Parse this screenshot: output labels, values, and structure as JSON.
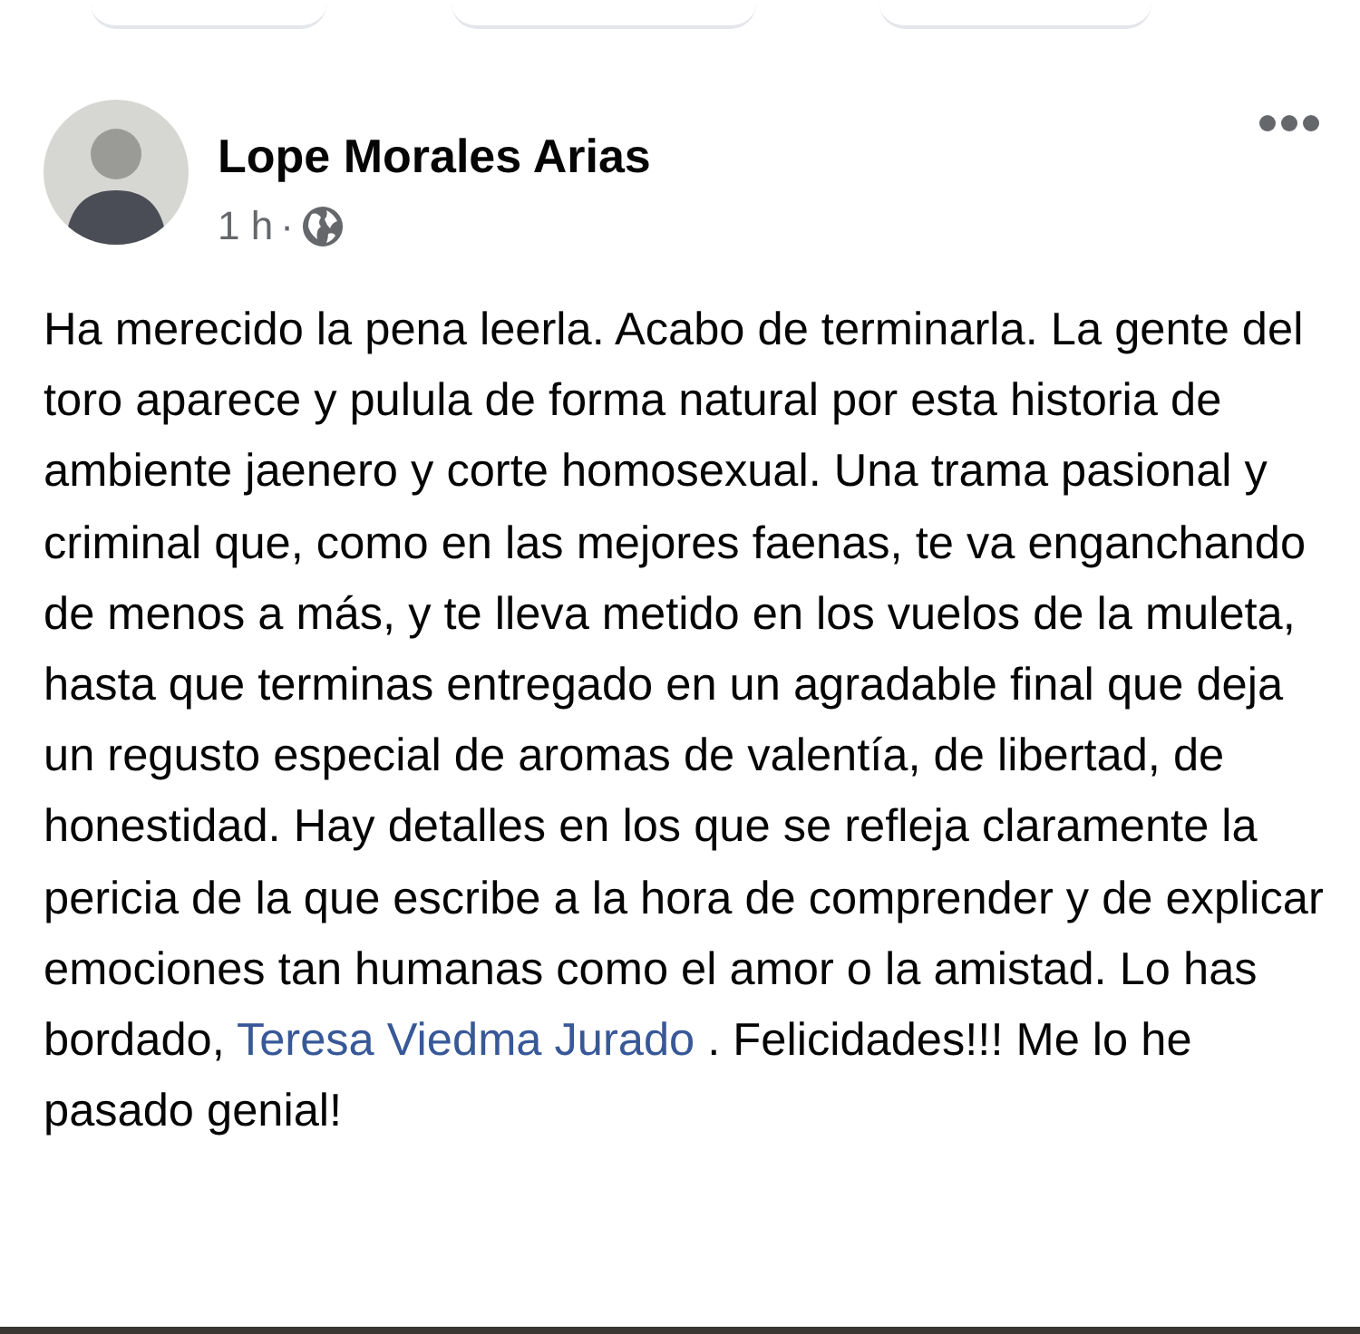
{
  "post": {
    "author": "Lope Morales Arias",
    "time": "1 h",
    "separator": "·",
    "body": {
      "before": "Ha merecido la pena leerla. Acabo de terminarla. La gente del toro aparece y pulula de forma natural por esta historia de ambiente jaenero y corte homosexual. Una trama pasional y criminal que, como en las mejores faenas, te va enganchando de menos a más, y te lleva metido en los vuelos de la muleta, hasta que terminas entregado en un agradable final que deja un regusto especial de aromas de valentía, de libertad, de honestidad. Hay detalles en los que se refleja claramente la pericia de la que escribe a la hora de comprender y de explicar  emociones tan humanas como el amor o la amistad. Lo has bordado, ",
      "mention": "Teresa Viedma Jurado",
      "after": " . Felicidades!!! Me lo he pasado genial!"
    }
  }
}
